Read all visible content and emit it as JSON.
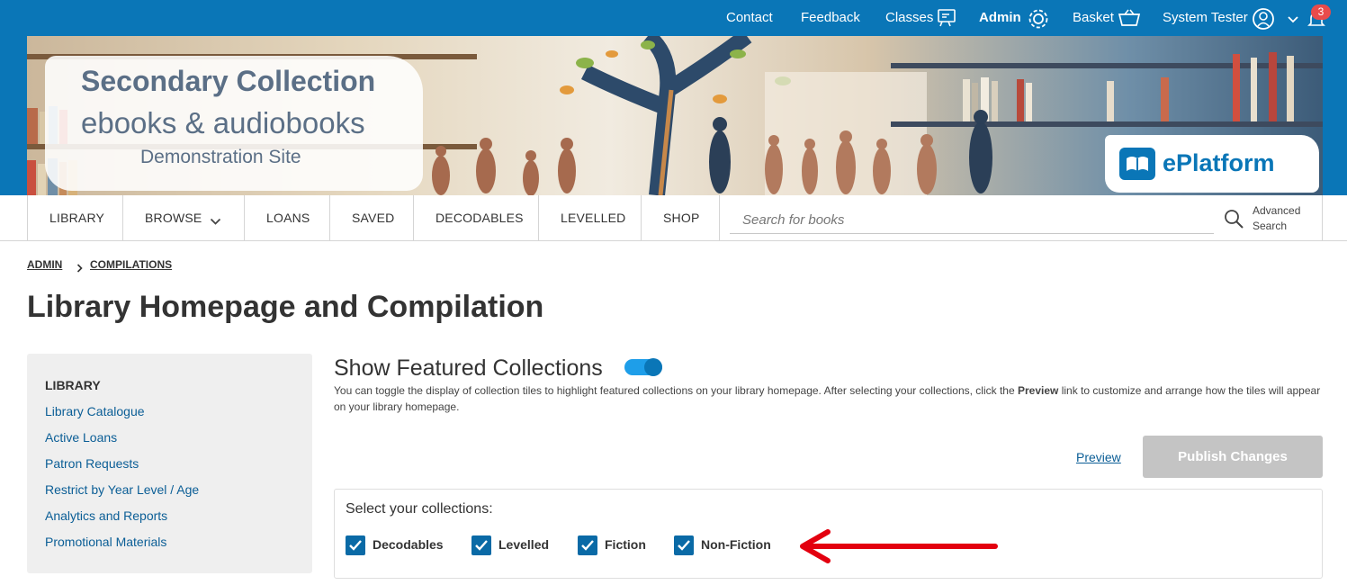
{
  "topbar": {
    "contact": "Contact",
    "feedback": "Feedback",
    "classes": "Classes",
    "admin": "Admin",
    "basket": "Basket",
    "user": "System Tester",
    "notification_count": "3",
    "background_color": "#0a76b7"
  },
  "banner": {
    "line1": "Secondary Collection",
    "line2": "ebooks & audiobooks",
    "line3": "Demonstration Site",
    "logo": "ePlatform"
  },
  "nav": {
    "items": [
      "LIBRARY",
      "BROWSE",
      "LOANS",
      "SAVED",
      "DECODABLES",
      "LEVELLED",
      "SHOP"
    ],
    "search_placeholder": "Search for books",
    "advanced_line1": "Advanced",
    "advanced_line2": "Search"
  },
  "breadcrumb": {
    "items": [
      "ADMIN",
      "COMPILATIONS"
    ]
  },
  "page": {
    "title": "Library Homepage and Compilation"
  },
  "sidebar": {
    "heading": "LIBRARY",
    "links": [
      "Library Catalogue",
      "Active Loans",
      "Patron Requests",
      "Restrict by Year Level / Age",
      "Analytics and Reports",
      "Promotional Materials"
    ]
  },
  "featured": {
    "title": "Show Featured Collections",
    "toggle_on": true,
    "desc_before": "You can toggle the display of collection tiles to highlight featured collections on your library homepage. After selecting your collections, click the ",
    "desc_bold": "Preview",
    "desc_after": " link to customize and arrange how the tiles will appear on your library homepage.",
    "preview_label": "Preview",
    "publish_label": "Publish Changes",
    "select_label": "Select your collections:",
    "collections": [
      {
        "label": "Decodables",
        "checked": true
      },
      {
        "label": "Levelled",
        "checked": true
      },
      {
        "label": "Fiction",
        "checked": true
      },
      {
        "label": "Non-Fiction",
        "checked": true
      }
    ],
    "arrow_color": "#e3000f"
  }
}
